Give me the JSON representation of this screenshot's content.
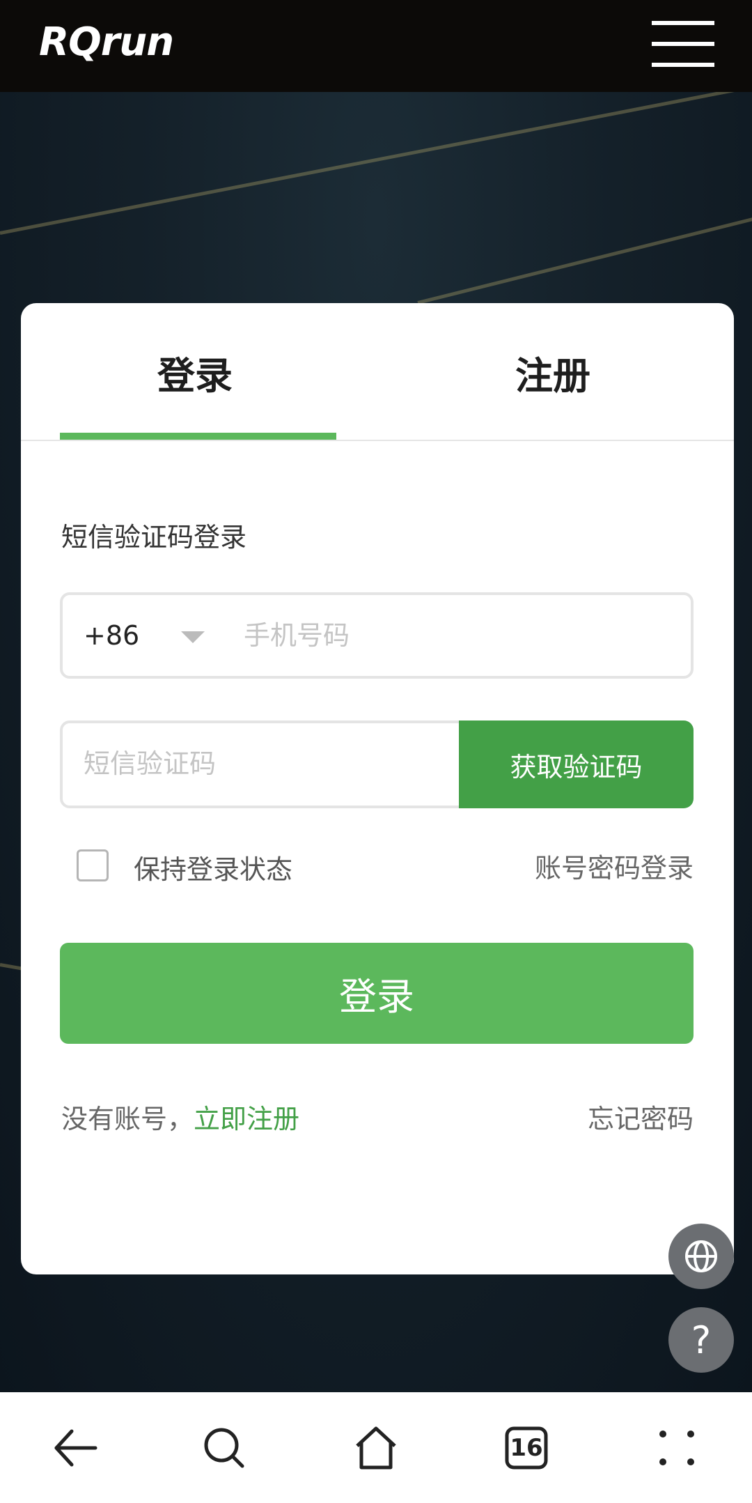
{
  "header": {
    "logo": "RQrun"
  },
  "tabs": {
    "login": "登录",
    "register": "注册"
  },
  "form": {
    "title": "短信验证码登录",
    "country_code": "+86",
    "phone_placeholder": "手机号码",
    "code_placeholder": "短信验证码",
    "get_code_label": "获取验证码",
    "remember_label": "保持登录状态",
    "password_login_label": "账号密码登录",
    "submit_label": "登录",
    "no_account_text": "没有账号，",
    "register_now_label": "立即注册",
    "forgot_password_label": "忘记密码"
  },
  "floating": {
    "help_label": "?"
  },
  "bottom_nav": {
    "tabs_count": "16"
  },
  "colors": {
    "accent": "#5cb85c",
    "accent_dark": "#43a047",
    "header_bg": "#0c0a08"
  }
}
